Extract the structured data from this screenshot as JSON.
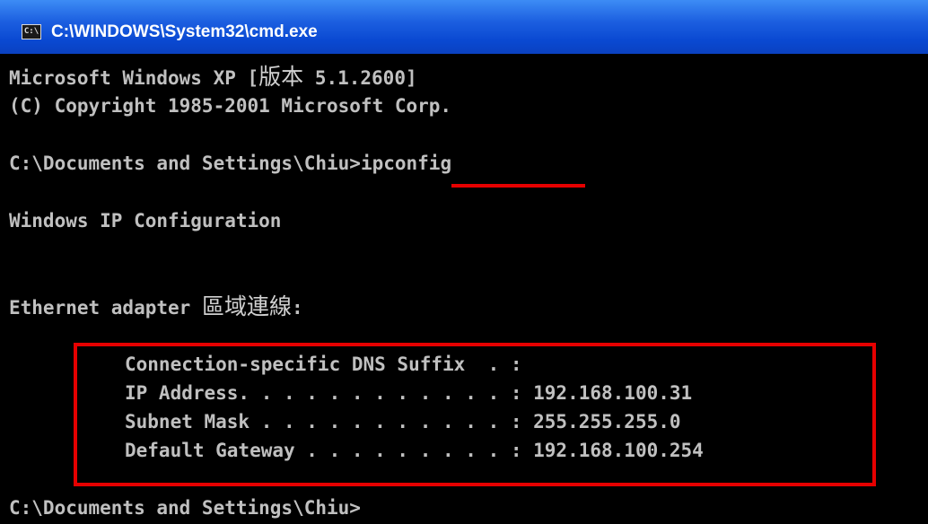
{
  "window": {
    "title": "C:\\WINDOWS\\System32\\cmd.exe",
    "icon_name": "cmd-console-icon",
    "icon_text": "C:\\"
  },
  "console": {
    "header_line1_prefix": "Microsoft Windows XP [",
    "header_line1_version_word": "版本",
    "header_line1_suffix": " 5.1.2600]",
    "header_line2": "(C) Copyright 1985-2001 Microsoft Corp.",
    "prompt1": "C:\\Documents and Settings\\Chiu>",
    "command": "ipconfig",
    "section_title": "Windows IP Configuration",
    "adapter_prefix": "Ethernet adapter ",
    "adapter_name": "區域連線",
    "adapter_colon": ":",
    "config_lines": [
      "Connection-specific DNS Suffix  . :",
      "IP Address. . . . . . . . . . . . : 192.168.100.31",
      "Subnet Mask . . . . . . . . . . . : 255.255.255.0",
      "Default Gateway . . . . . . . . . : 192.168.100.254"
    ],
    "prompt2": "C:\\Documents and Settings\\Chiu>"
  },
  "annotations": {
    "highlight_color": "#e60000"
  }
}
